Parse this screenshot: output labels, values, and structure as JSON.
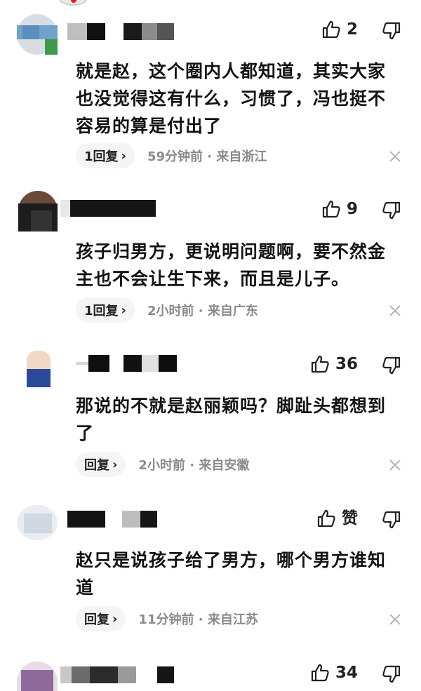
{
  "comments": [
    {
      "likes": "2",
      "text": "就是赵，这个圈内人都知道，其实大家也没觉得这有什么，习惯了，冯也挺不容易的算是付出了",
      "reply_label": "1回复",
      "meta": "59分钟前 · 来自浙江"
    },
    {
      "likes": "9",
      "text": "孩子归男方，更说明问题啊，要不然金主也不会让生下来，而且是儿子。",
      "reply_label": "1回复",
      "meta": "2小时前 · 来自广东"
    },
    {
      "likes": "36",
      "text": "那说的不就是赵丽颖吗？脚趾头都想到了",
      "reply_label": "回复",
      "meta": "2小时前 · 来自安徽"
    },
    {
      "likes": "赞",
      "text": "赵只是说孩子给了男方，哪个男方谁知道",
      "reply_label": "回复",
      "meta": "11分钟前 · 来自江苏"
    },
    {
      "likes": "34"
    }
  ],
  "icons": {
    "like": "thumbs-up-icon",
    "dislike": "thumbs-down-icon",
    "close": "close-icon",
    "chevron": "chevron-right-icon"
  },
  "reply_chevron": "›"
}
